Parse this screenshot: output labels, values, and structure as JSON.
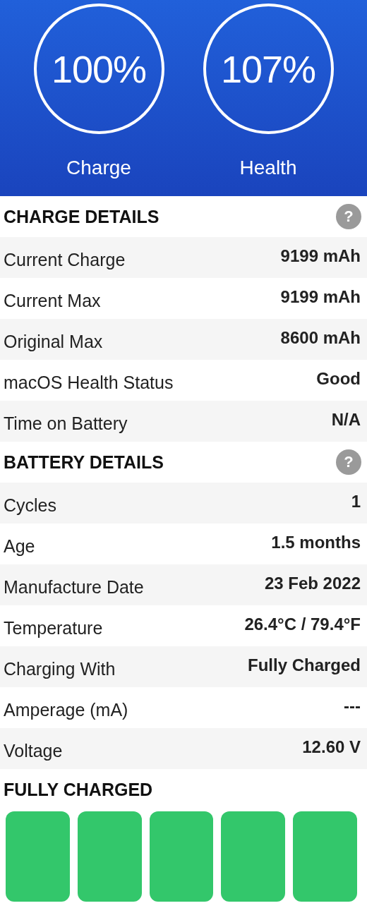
{
  "gauges": [
    {
      "value": "100%",
      "label": "Charge"
    },
    {
      "value": "107%",
      "label": "Health"
    }
  ],
  "sections": [
    {
      "title": "CHARGE DETAILS",
      "help": "?",
      "rows": [
        {
          "label": "Current Charge",
          "value": "9199 mAh"
        },
        {
          "label": "Current Max",
          "value": "9199 mAh"
        },
        {
          "label": "Original Max",
          "value": "8600 mAh"
        },
        {
          "label": "macOS Health Status",
          "value": "Good"
        },
        {
          "label": "Time on Battery",
          "value": "N/A"
        }
      ]
    },
    {
      "title": "BATTERY DETAILS",
      "help": "?",
      "rows": [
        {
          "label": "Cycles",
          "value": "1"
        },
        {
          "label": "Age",
          "value": "1.5 months"
        },
        {
          "label": "Manufacture Date",
          "value": "23 Feb 2022"
        },
        {
          "label": "Temperature",
          "value": "26.4°C / 79.4°F"
        },
        {
          "label": "Charging With",
          "value": "Fully Charged"
        },
        {
          "label": "Amperage (mA)",
          "value": "---"
        },
        {
          "label": "Voltage",
          "value": "12.60 V"
        }
      ]
    }
  ],
  "status": {
    "title": "FULLY CHARGED",
    "segments": [
      {
        "filled": true
      },
      {
        "filled": true
      },
      {
        "filled": true
      },
      {
        "filled": true
      },
      {
        "filled": true
      }
    ]
  }
}
